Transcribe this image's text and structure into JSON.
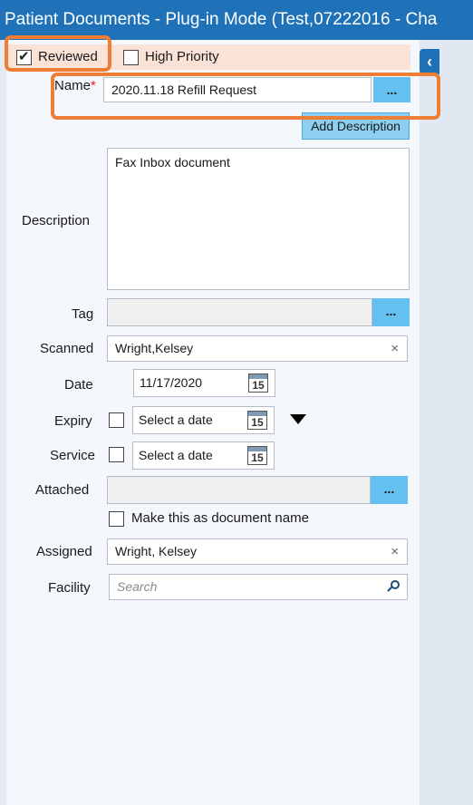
{
  "window": {
    "title": "Patient Documents - Plug-in Mode  (Test,07222016 - Cha"
  },
  "header": {
    "reviewed_label": "Reviewed",
    "reviewed_checked": true,
    "high_priority_label": "High Priority",
    "high_priority_checked": false
  },
  "collapse_tab": {
    "glyph": "‹",
    "icon": "chevron-left-icon"
  },
  "form": {
    "name": {
      "label": "Name",
      "required_mark": "*",
      "value": "2020.11.18 Refill Request",
      "browse_label": "..."
    },
    "add_description_label": "Add Description",
    "description": {
      "label": "Description",
      "value": "Fax Inbox document"
    },
    "tag": {
      "label": "Tag",
      "value": "",
      "browse_label": "..."
    },
    "scanned": {
      "label": "Scanned",
      "value": "Wright,Kelsey",
      "clear_glyph": "×"
    },
    "date": {
      "label": "Date",
      "value": "11/17/2020",
      "calendar_day": "15"
    },
    "expiry": {
      "label": "Expiry",
      "checked": false,
      "placeholder": "Select a date",
      "calendar_day": "15"
    },
    "service": {
      "label": "Service",
      "checked": false,
      "placeholder": "Select a date",
      "calendar_day": "15"
    },
    "attached": {
      "label": "Attached",
      "value": "",
      "browse_label": "..."
    },
    "make_document_name": {
      "label": "Make this as document name",
      "checked": false
    },
    "assigned": {
      "label": "Assigned",
      "value": "Wright, Kelsey",
      "clear_glyph": "×"
    },
    "facility": {
      "label": "Facility",
      "placeholder": "Search"
    }
  },
  "colors": {
    "title_bar": "#1f72b8",
    "highlight": "#ee7d35",
    "browse_button": "#63c0f0",
    "header_strip": "#fbe2d6"
  }
}
